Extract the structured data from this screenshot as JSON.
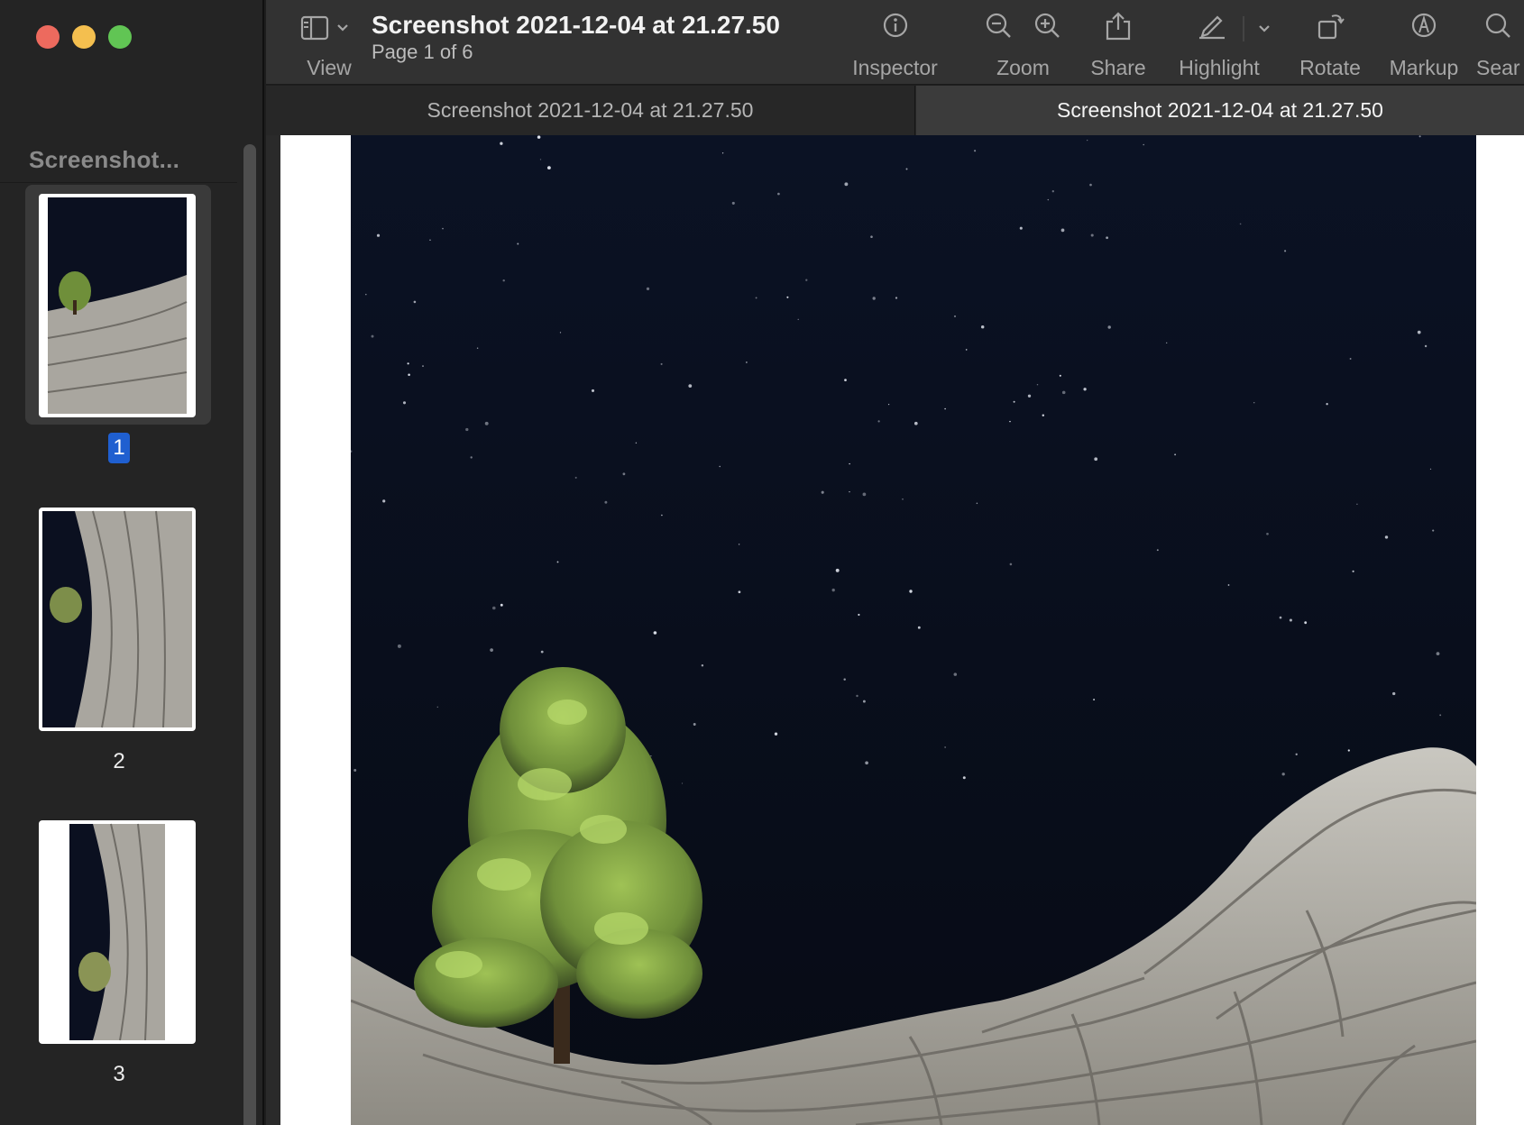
{
  "window": {
    "title": "Screenshot 2021-12-04 at 21.27.50",
    "subtitle": "Page 1 of 6"
  },
  "sidebar": {
    "title": "Screenshot...",
    "thumbnails": [
      {
        "number": "1",
        "selected": true
      },
      {
        "number": "2",
        "selected": false
      },
      {
        "number": "3",
        "selected": false
      }
    ]
  },
  "toolbar": {
    "view_label": "View",
    "inspector_label": "Inspector",
    "zoom_label": "Zoom",
    "share_label": "Share",
    "highlight_label": "Highlight",
    "rotate_label": "Rotate",
    "markup_label": "Markup",
    "search_label": "Sear"
  },
  "tabs": [
    {
      "label": "Screenshot 2021-12-04 at 21.27.50",
      "active": false
    },
    {
      "label": "Screenshot 2021-12-04 at 21.27.50",
      "active": true
    }
  ],
  "icons": {
    "sidebar_toggle": "sidebar-icon",
    "inspector": "info-icon",
    "zoom_out": "zoom-out-icon",
    "zoom_in": "zoom-in-icon",
    "share": "share-icon",
    "highlight": "pencil-icon",
    "rotate": "rotate-icon",
    "markup": "markup-icon",
    "search": "search-icon"
  },
  "colors": {
    "selection": "#1f5fd0",
    "sky": "#0a0f1f",
    "tree": "#7fa544",
    "rock": "#b9b7b0"
  }
}
